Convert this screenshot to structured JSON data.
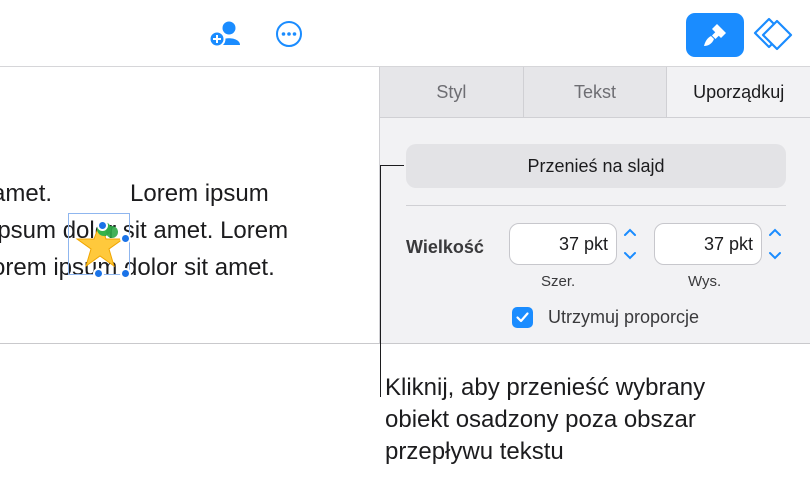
{
  "toolbar": {
    "collaborate_icon": "add-collaborator-icon",
    "more_icon": "ellipsis-icon",
    "format_icon": "paintbrush-icon",
    "document_icon": "document-diamond-icon",
    "accent_color": "#1a8cff"
  },
  "canvas": {
    "text_lines": [
      "amet.",
      "Lorem ipsum",
      "ipsum dolor sit amet. Lorem",
      "orem ipsum dolor sit amet."
    ],
    "object_icon": "star-icon"
  },
  "sidebar": {
    "tabs": [
      {
        "label": "Styl",
        "active": false
      },
      {
        "label": "Tekst",
        "active": false
      },
      {
        "label": "Uporządkuj",
        "active": true
      }
    ],
    "move_button_label": "Przenieś na slajd",
    "size_label": "Wielkość",
    "width_value": "37 pkt",
    "height_value": "37 pkt",
    "width_caption": "Szer.",
    "height_caption": "Wys.",
    "constrain_label": "Utrzymuj proporcje",
    "constrain_checked": true
  },
  "callout": {
    "lines": [
      "Kliknij, aby przenieść wybrany",
      "obiekt osadzony poza obszar",
      "przepływu tekstu"
    ]
  }
}
